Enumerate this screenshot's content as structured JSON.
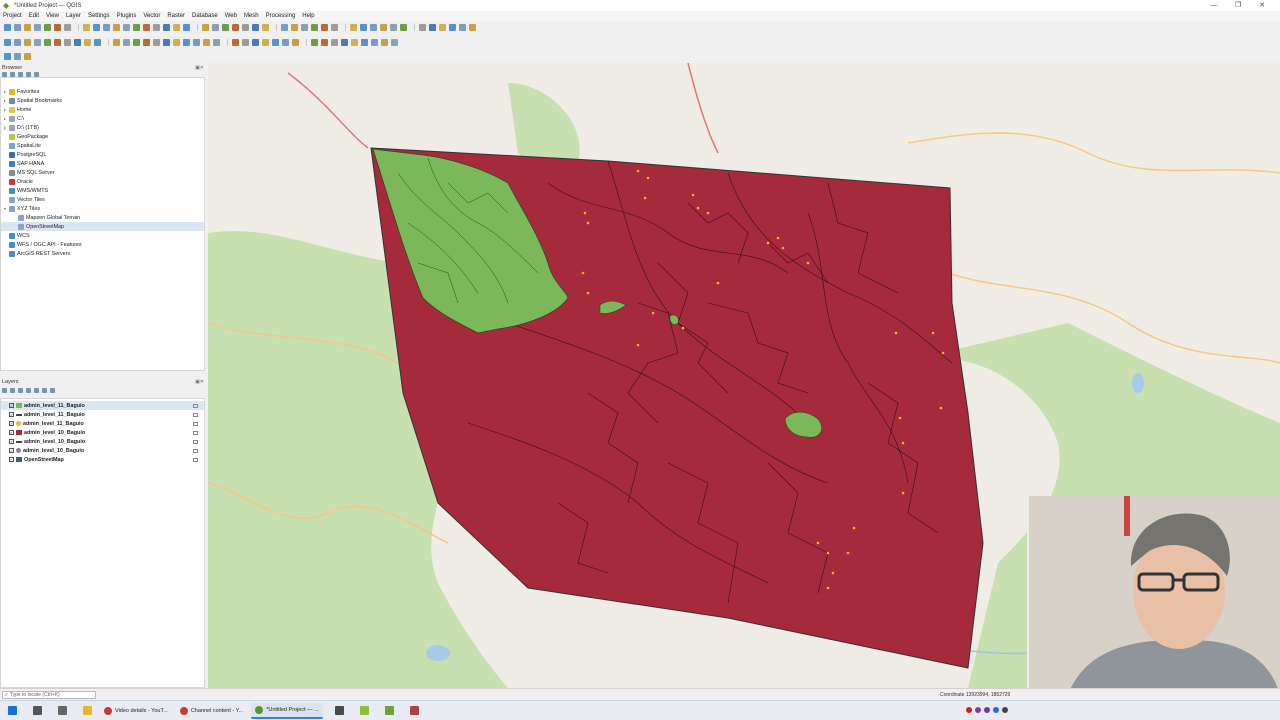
{
  "window": {
    "title": "*Untitled Project — QGIS",
    "app_icon": "qgis-icon",
    "controls": [
      "—",
      "❐",
      "✕"
    ]
  },
  "menu": [
    "Project",
    "Edit",
    "View",
    "Layer",
    "Settings",
    "Plugins",
    "Vector",
    "Raster",
    "Database",
    "Web",
    "Mesh",
    "Processing",
    "Help"
  ],
  "browser": {
    "title": "Browser",
    "items": [
      {
        "label": "Favorites",
        "icon": "star-icon",
        "color": "#e7b416",
        "indent": 1,
        "arrow": "▸"
      },
      {
        "label": "Spatial Bookmarks",
        "icon": "bookmark-icon",
        "color": "#6a88b8",
        "indent": 1,
        "arrow": "▸"
      },
      {
        "label": "Home",
        "icon": "folder-icon",
        "color": "#e6c15a",
        "indent": 1,
        "arrow": "▸"
      },
      {
        "label": "C:\\",
        "icon": "drive-icon",
        "color": "#9aa4b0",
        "indent": 1,
        "arrow": "▸"
      },
      {
        "label": "D:\\ (1TB)",
        "icon": "drive-icon",
        "color": "#9aa4b0",
        "indent": 1,
        "arrow": "▸"
      },
      {
        "label": "GeoPackage",
        "icon": "geopackage-icon",
        "color": "#b4c84e",
        "indent": 1,
        "arrow": ""
      },
      {
        "label": "SpatiaLite",
        "icon": "spatialite-icon",
        "color": "#7aa3d8",
        "indent": 1,
        "arrow": ""
      },
      {
        "label": "PostgreSQL",
        "icon": "postgres-icon",
        "color": "#3f6aa3",
        "indent": 1,
        "arrow": ""
      },
      {
        "label": "SAP HANA",
        "icon": "database-icon",
        "color": "#3b7fc4",
        "indent": 1,
        "arrow": ""
      },
      {
        "label": "MS SQL Server",
        "icon": "database-icon",
        "color": "#8a8a8a",
        "indent": 1,
        "arrow": ""
      },
      {
        "label": "Oracle",
        "icon": "database-icon",
        "color": "#c8382c",
        "indent": 1,
        "arrow": ""
      },
      {
        "label": "WMS/WMTS",
        "icon": "globe-icon",
        "color": "#4a8ad0",
        "indent": 1,
        "arrow": ""
      },
      {
        "label": "Vector Tiles",
        "icon": "grid-icon",
        "color": "#8aa2c8",
        "indent": 1,
        "arrow": ""
      },
      {
        "label": "XYZ Tiles",
        "icon": "grid-icon",
        "color": "#8aa2c8",
        "indent": 1,
        "arrow": "▾"
      },
      {
        "label": "Mapzen Global Terrain",
        "icon": "grid-icon",
        "color": "#8aa2c8",
        "indent": 2,
        "arrow": ""
      },
      {
        "label": "OpenStreetMap",
        "icon": "grid-icon",
        "color": "#8aa2c8",
        "indent": 2,
        "arrow": "",
        "selected": true
      },
      {
        "label": "WCS",
        "icon": "globe-icon",
        "color": "#4a8ad0",
        "indent": 1,
        "arrow": ""
      },
      {
        "label": "WFS / OGC API - Features",
        "icon": "globe-icon",
        "color": "#4a8ad0",
        "indent": 1,
        "arrow": ""
      },
      {
        "label": "ArcGIS REST Servers",
        "icon": "globe-icon",
        "color": "#4a8ad0",
        "indent": 1,
        "arrow": ""
      }
    ]
  },
  "layers": {
    "title": "Layers",
    "items": [
      {
        "label": "admin_level_11_Baguio",
        "symbol": "polygon-icon",
        "color": "#7ab85a",
        "checked": true,
        "selected": true
      },
      {
        "label": "admin_level_11_Baguio",
        "symbol": "line-icon",
        "color": "#444444",
        "checked": true
      },
      {
        "label": "admin_level_11_Baguio",
        "symbol": "point-icon",
        "color": "#e8b83a",
        "checked": true
      },
      {
        "label": "admin_level_10_Baguio",
        "symbol": "polygon-icon",
        "color": "#a52a3c",
        "checked": true
      },
      {
        "label": "admin_level_10_Baguio",
        "symbol": "line-icon",
        "color": "#444444",
        "checked": true
      },
      {
        "label": "admin_level_10_Baguio",
        "symbol": "point-icon",
        "color": "#888888",
        "checked": true
      },
      {
        "label": "OpenStreetMap",
        "symbol": "grid-icon",
        "color": "#3c5a8a",
        "checked": true
      }
    ]
  },
  "map": {
    "base_color": "#eeece4",
    "fill_red": "#a52a3c",
    "fill_green": "#7ab85a",
    "forest_color": "#c8dfb0",
    "road_color": "#f3c78a"
  },
  "status": {
    "locator_placeholder": "Type to locate (Ctrl+K)",
    "coordinate": "Coordinate  13923994, 1852729"
  },
  "taskbar": {
    "tasks": [
      {
        "label": "Video details - YouT...",
        "color": "#c33c3c",
        "active": false
      },
      {
        "label": "Channel content - Y...",
        "color": "#c33c3c",
        "active": false
      },
      {
        "label": "*Untitled Project — ...",
        "color": "#589632",
        "active": true
      }
    ]
  }
}
